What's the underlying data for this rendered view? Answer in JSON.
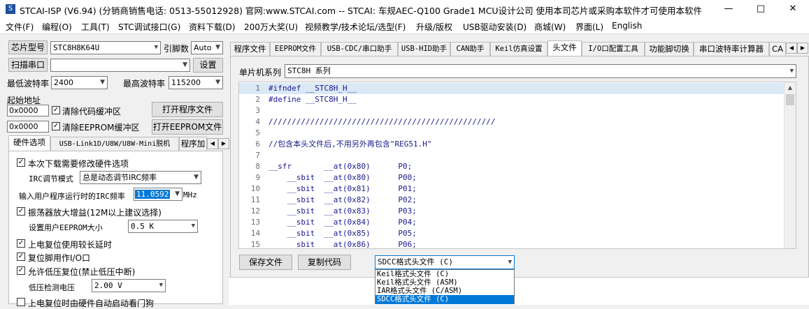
{
  "window": {
    "title": "STCAI-ISP (V6.94) (分销商销售电话: 0513-55012928) 官网:www.STCAI.com  -- STCAI: 车规AEC-Q100 Grade1 MCU设计公司 使用本司芯片或采购本软件才可使用本软件"
  },
  "menu": [
    "文件(F)",
    "编程(O)",
    "工具(T)",
    "STC调试接口(G)",
    "资料下载(D)",
    "200万大奖(U)",
    "视频教学/技术论坛/选型(F)",
    "升级/版权",
    "USB驱动安装(D)",
    "商城(W)",
    "界面(L)",
    "English"
  ],
  "left": {
    "chip_label": "芯片型号",
    "chip_value": "STC8H8K64U",
    "pins_label": "引脚数",
    "pins_value": "Auto",
    "scan_button": "扫描串口",
    "port_value": "",
    "settings_button": "设置",
    "min_baud_label": "最低波特率",
    "min_baud_value": "2400",
    "max_baud_label": "最高波特率",
    "max_baud_value": "115200",
    "start_addr_label": "起始地址",
    "addr1": "0x0000",
    "clear_code": "清除代码缓冲区",
    "open_prog": "打开程序文件",
    "addr2": "0x0000",
    "clear_eeprom": "清除EEPROM缓冲区",
    "open_eeprom": "打开EEPROM文件",
    "tabs": [
      "硬件选项",
      "USB-Link1D/U8W/U8W-Mini脱机",
      "程序加"
    ],
    "hw": {
      "opt1": "本次下载需要修改硬件选项",
      "irc_label": "IRC调节模式",
      "irc_value": "总是动态调节IRC频率",
      "freq_label": "输入用户程序运行时的IRC频率",
      "freq_value": "11.0592",
      "freq_unit": "MHz",
      "osc": "振荡器放大增益(12M以上建议选择)",
      "eeprom_label": "设置用户EEPROM大小",
      "eeprom_value": "0.5 K",
      "opt_reset_delay": "上电复位使用较长延时",
      "opt_reset_pin": "复位脚用作I/O口",
      "opt_lvd": "允许低压复位(禁止低压中断)",
      "lvd_label": "低压检测电压",
      "lvd_value": "2.00 V",
      "opt_wdt": "上电复位时由硬件自动启动看门狗"
    }
  },
  "right": {
    "tabs": [
      "程序文件",
      "EEPROM文件",
      "USB-CDC/串口助手",
      "USB-HID助手",
      "CAN助手",
      "Keil仿真设置",
      "头文件",
      "I/O口配置工具",
      "功能脚切换",
      "串口波特率计算器",
      "CA"
    ],
    "series_label": "单片机系列",
    "series_value": "STC8H 系列",
    "code_lines": [
      {
        "n": "1",
        "t": "#ifndef __STC8H_H__"
      },
      {
        "n": "2",
        "t": "#define __STC8H_H__"
      },
      {
        "n": "3",
        "t": ""
      },
      {
        "n": "4",
        "t": "/////////////////////////////////////////////////"
      },
      {
        "n": "5",
        "t": ""
      },
      {
        "n": "6",
        "t": "//包含本头文件后,不用另外再包含\"REG51.H\""
      },
      {
        "n": "7",
        "t": ""
      },
      {
        "n": "8",
        "t": "__sfr       __at(0x80)      P0;"
      },
      {
        "n": "9",
        "t": "    __sbit  __at(0x80)      P00;"
      },
      {
        "n": "10",
        "t": "    __sbit  __at(0x81)      P01;"
      },
      {
        "n": "11",
        "t": "    __sbit  __at(0x82)      P02;"
      },
      {
        "n": "12",
        "t": "    __sbit  __at(0x83)      P03;"
      },
      {
        "n": "13",
        "t": "    __sbit  __at(0x84)      P04;"
      },
      {
        "n": "14",
        "t": "    __sbit  __at(0x85)      P05;"
      },
      {
        "n": "15",
        "t": "    __sbit  __at(0x86)      P06;"
      }
    ],
    "save_button": "保存文件",
    "copy_button": "复制代码",
    "format_value": "SDCC格式头文件 (C)",
    "format_options": [
      "Keil格式头文件 (C)",
      "Keil格式头文件 (ASM)",
      "IAR格式头文件 (C/ASM)",
      "SDCC格式头文件 (C)"
    ],
    "selected_option": 3
  },
  "colors": {
    "accent": "#0078d7",
    "code_text": "#1a1a8c",
    "highlight_line": "#dbe9f7"
  }
}
